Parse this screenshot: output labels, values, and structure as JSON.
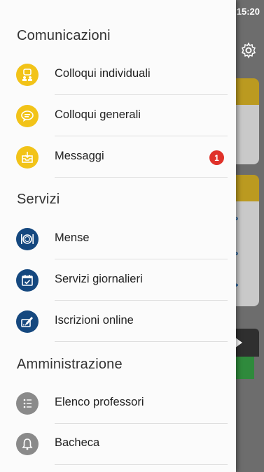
{
  "status_bar": {
    "time": "15:20"
  },
  "drawer": {
    "sections": [
      {
        "title": "Comunicazioni",
        "items": [
          {
            "label": "Colloqui individuali",
            "icon": "people-meeting-icon",
            "color": "#f2c318"
          },
          {
            "label": "Colloqui generali",
            "icon": "chat-bubble-icon",
            "color": "#f2c318"
          },
          {
            "label": "Messaggi",
            "icon": "inbox-icon",
            "color": "#f2c318",
            "badge": "1"
          }
        ]
      },
      {
        "title": "Servizi",
        "items": [
          {
            "label": "Mense",
            "icon": "plate-cutlery-icon",
            "color": "#15487f"
          },
          {
            "label": "Servizi giornalieri",
            "icon": "calendar-check-icon",
            "color": "#15487f"
          },
          {
            "label": "Iscrizioni online",
            "icon": "edit-form-icon",
            "color": "#15487f"
          }
        ]
      },
      {
        "title": "Amministrazione",
        "items": [
          {
            "label": "Elenco professori",
            "icon": "list-icon",
            "color": "#8a8a8a"
          },
          {
            "label": "Bacheca",
            "icon": "bell-icon",
            "color": "#8a8a8a"
          }
        ]
      }
    ]
  }
}
